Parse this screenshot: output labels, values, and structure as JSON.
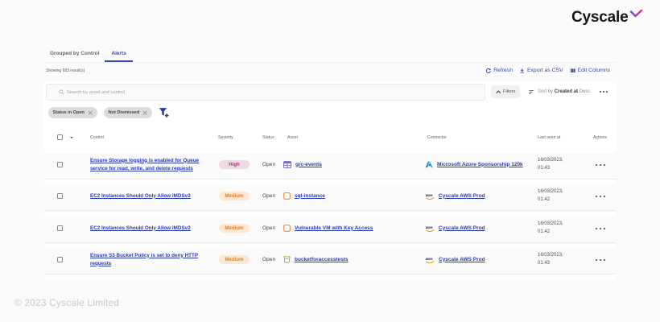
{
  "logo": {
    "text": "Cyscale"
  },
  "tabs": [
    {
      "label": "Grouped by Control",
      "active": false
    },
    {
      "label": "Alerts",
      "active": true
    }
  ],
  "summary": "Showing 683 result(s)",
  "toolbar": {
    "refresh": "Refresh",
    "export_csv": "Export as CSV",
    "edit_columns": "Edit Columns"
  },
  "search": {
    "placeholder": "Search by asset and control"
  },
  "filters_button": "Filters",
  "sort": {
    "prefix": "Sort by",
    "field": "Created at",
    "direction": "Desc."
  },
  "filter_chips": [
    {
      "label": "Status in Open"
    },
    {
      "label": "Not Dismissed"
    }
  ],
  "table": {
    "columns": [
      "Control",
      "Severity",
      "Status",
      "Asset",
      "Connector",
      "Last seen at",
      "Actions"
    ],
    "rows": [
      {
        "control": "Ensure Storage logging is enabled for Queue service for read, write, and delete requests",
        "severity": "High",
        "status": "Open",
        "asset": "grc-events",
        "asset_icon": "table-asset-icon",
        "connector": "Microsoft Azure Sponsorship 120k",
        "connector_icon": "azure-icon",
        "last_seen_date": "16/03/2023,",
        "last_seen_time": "01:43"
      },
      {
        "control": "EC2 Instances Should Only Allow IMDSv2",
        "severity": "Medium",
        "status": "Open",
        "asset": "sql-instance",
        "asset_icon": "instance-asset-icon",
        "connector": "Cyscale AWS Prod",
        "connector_icon": "aws-icon",
        "last_seen_date": "16/03/2023,",
        "last_seen_time": "01:42"
      },
      {
        "control": "EC2 Instances Should Only Allow IMDSv2",
        "severity": "Medium",
        "status": "Open",
        "asset": "Vulnerable VM with Key Access",
        "asset_icon": "instance-asset-icon",
        "connector": "Cyscale AWS Prod",
        "connector_icon": "aws-icon",
        "last_seen_date": "16/03/2023,",
        "last_seen_time": "01:42"
      },
      {
        "control": "Ensure S3 Bucket Policy is set to deny HTTP requests",
        "severity": "Medium",
        "status": "Open",
        "asset": "bucketforaccesstests",
        "asset_icon": "bucket-asset-icon",
        "connector": "Cyscale AWS Prod",
        "connector_icon": "aws-icon",
        "last_seen_date": "16/03/2023,",
        "last_seen_time": "01:43"
      }
    ]
  },
  "footer": "© 2023 Cyscale Limited",
  "colors": {
    "accent": "#3a47b1",
    "high_badge_bg": "#f5d9e5",
    "high_badge_text": "#bf3073",
    "medium_badge_bg": "#fbe7d2",
    "medium_badge_text": "#e0802a",
    "page_bg": "#fafafb",
    "card_bg": "#ffffff",
    "row_bg": "#fafafb"
  }
}
